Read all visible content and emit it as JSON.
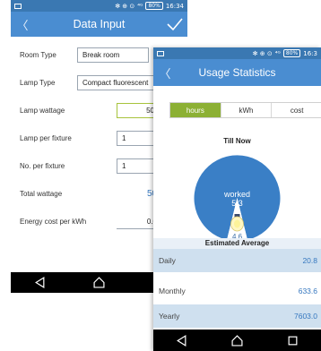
{
  "colors": {
    "accent": "#4a8dd1",
    "green": "#8cb034",
    "value_blue": "#3577bf"
  },
  "phone1": {
    "status": {
      "icons": "✻ ⊕ ⊙",
      "signal": "⁴ᴳ",
      "battery": "80%",
      "time": "16:34"
    },
    "title": "Data Input",
    "fields": {
      "room_type": {
        "label": "Room Type",
        "value": "Break room"
      },
      "lamp_type": {
        "label": "Lamp Type",
        "value": "Compact fluorescent"
      },
      "lamp_wattage": {
        "label": "Lamp wattage",
        "value": "50"
      },
      "lamp_per_fixture": {
        "label": "Lamp per fixture",
        "value": "1"
      },
      "no_per_fixture": {
        "label": "No. per fixture",
        "value": "1"
      },
      "total_wattage": {
        "label": "Total wattage",
        "value": "50"
      },
      "energy_cost": {
        "label": "Energy cost per kWh",
        "value": "0.0"
      }
    }
  },
  "phone2": {
    "status": {
      "icons": "✻ ⊕ ⊙",
      "signal": "⁴ᴳ",
      "battery": "80%",
      "time": "16:3"
    },
    "title": "Usage Statistics",
    "tabs": [
      "hours",
      "kWh",
      "cost"
    ],
    "active_tab": "hours",
    "till_now": "Till Now",
    "pie": {
      "worked_label": "worked",
      "worked_value": "5.3",
      "other_value": "4.6"
    },
    "estimated_average": "Estimated Average",
    "rows": [
      {
        "label": "Daily",
        "value": "20.8"
      },
      {
        "label": "Monthly",
        "value": "633.6"
      },
      {
        "label": "Yearly",
        "value": "7603.0"
      }
    ]
  }
}
